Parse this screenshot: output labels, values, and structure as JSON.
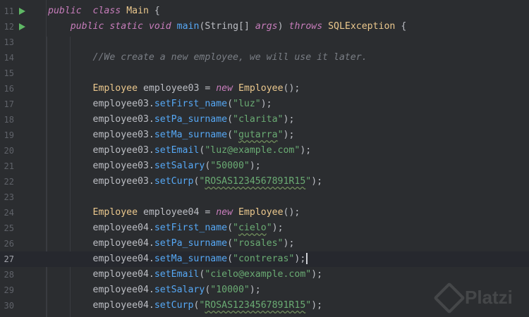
{
  "editor": {
    "lines": [
      {
        "num": "11",
        "run": true,
        "tokens": [
          [
            "kw-i",
            "public"
          ],
          [
            "",
            "  "
          ],
          [
            "kw-i",
            "class"
          ],
          [
            "",
            " "
          ],
          [
            "cls",
            "Main"
          ],
          [
            "",
            " {"
          ]
        ]
      },
      {
        "num": "12",
        "run": true,
        "tokens": [
          [
            "",
            "    "
          ],
          [
            "kw-i",
            "public"
          ],
          [
            "",
            " "
          ],
          [
            "kw-i",
            "static"
          ],
          [
            "",
            " "
          ],
          [
            "kw-i",
            "void"
          ],
          [
            "",
            " "
          ],
          [
            "fn",
            "main"
          ],
          [
            "",
            "(String[] "
          ],
          [
            "kw-i",
            "args"
          ],
          [
            "",
            ") "
          ],
          [
            "kw-i",
            "throws"
          ],
          [
            "",
            " "
          ],
          [
            "cls",
            "SQLException"
          ],
          [
            "",
            " {"
          ]
        ]
      },
      {
        "num": "13",
        "tokens": []
      },
      {
        "num": "14",
        "tokens": [
          [
            "",
            "        "
          ],
          [
            "cmt",
            "//We create a new employee, we will use it later."
          ]
        ]
      },
      {
        "num": "15",
        "tokens": []
      },
      {
        "num": "16",
        "tokens": [
          [
            "",
            "        "
          ],
          [
            "cls",
            "Employee"
          ],
          [
            "",
            " employee03 = "
          ],
          [
            "kw-i",
            "new"
          ],
          [
            "",
            " "
          ],
          [
            "cls",
            "Employee"
          ],
          [
            "",
            "();"
          ]
        ]
      },
      {
        "num": "17",
        "tokens": [
          [
            "",
            "        employee03."
          ],
          [
            "fn",
            "setFirst_name"
          ],
          [
            "",
            "("
          ],
          [
            "str",
            "\"luz\""
          ],
          [
            "",
            ");"
          ]
        ]
      },
      {
        "num": "18",
        "tokens": [
          [
            "",
            "        employee03."
          ],
          [
            "fn",
            "setPa_surname"
          ],
          [
            "",
            "("
          ],
          [
            "str",
            "\"clarita\""
          ],
          [
            "",
            ");"
          ]
        ]
      },
      {
        "num": "19",
        "tokens": [
          [
            "",
            "        employee03."
          ],
          [
            "fn",
            "setMa_surname"
          ],
          [
            "",
            "("
          ],
          [
            "str",
            "\""
          ],
          [
            "str wavy",
            "gutarra"
          ],
          [
            "str",
            "\""
          ],
          [
            "",
            ");"
          ]
        ]
      },
      {
        "num": "20",
        "tokens": [
          [
            "",
            "        employee03."
          ],
          [
            "fn",
            "setEmail"
          ],
          [
            "",
            "("
          ],
          [
            "str",
            "\"luz@example.com\""
          ],
          [
            "",
            ");"
          ]
        ]
      },
      {
        "num": "21",
        "tokens": [
          [
            "",
            "        employee03."
          ],
          [
            "fn",
            "setSalary"
          ],
          [
            "",
            "("
          ],
          [
            "str",
            "\"50000\""
          ],
          [
            "",
            ");"
          ]
        ]
      },
      {
        "num": "22",
        "tokens": [
          [
            "",
            "        employee03."
          ],
          [
            "fn",
            "setCurp"
          ],
          [
            "",
            "("
          ],
          [
            "str",
            "\""
          ],
          [
            "str wavy",
            "ROSAS1234567891R15"
          ],
          [
            "str",
            "\""
          ],
          [
            "",
            ");"
          ]
        ]
      },
      {
        "num": "23",
        "tokens": []
      },
      {
        "num": "24",
        "tokens": [
          [
            "",
            "        "
          ],
          [
            "cls",
            "Employee"
          ],
          [
            "",
            " employee04 = "
          ],
          [
            "kw-i",
            "new"
          ],
          [
            "",
            " "
          ],
          [
            "cls",
            "Employee"
          ],
          [
            "",
            "();"
          ]
        ]
      },
      {
        "num": "25",
        "tokens": [
          [
            "",
            "        employee04."
          ],
          [
            "fn",
            "setFirst_name"
          ],
          [
            "",
            "("
          ],
          [
            "str",
            "\""
          ],
          [
            "str wavy",
            "cielo"
          ],
          [
            "str",
            "\""
          ],
          [
            "",
            ");"
          ]
        ]
      },
      {
        "num": "26",
        "tokens": [
          [
            "",
            "        employee04."
          ],
          [
            "fn",
            "setPa_surname"
          ],
          [
            "",
            "("
          ],
          [
            "str",
            "\"rosales\""
          ],
          [
            "",
            ");"
          ]
        ]
      },
      {
        "num": "27",
        "current": true,
        "tokens": [
          [
            "",
            "        employee04."
          ],
          [
            "fn",
            "setMa_surname"
          ],
          [
            "",
            "("
          ],
          [
            "str",
            "\"contreras\""
          ],
          [
            "",
            ");"
          ]
        ]
      },
      {
        "num": "28",
        "tokens": [
          [
            "",
            "        employee04."
          ],
          [
            "fn",
            "setEmail"
          ],
          [
            "",
            "("
          ],
          [
            "str",
            "\"cielo@example.com\""
          ],
          [
            "",
            ");"
          ]
        ]
      },
      {
        "num": "29",
        "tokens": [
          [
            "",
            "        employee04."
          ],
          [
            "fn",
            "setSalary"
          ],
          [
            "",
            "("
          ],
          [
            "str",
            "\"10000\""
          ],
          [
            "",
            ");"
          ]
        ]
      },
      {
        "num": "30",
        "tokens": [
          [
            "",
            "        employee04."
          ],
          [
            "fn",
            "setCurp"
          ],
          [
            "",
            "("
          ],
          [
            "str",
            "\""
          ],
          [
            "str wavy",
            "ROSAS1234567891R15"
          ],
          [
            "str",
            "\""
          ],
          [
            "",
            ");"
          ]
        ]
      }
    ]
  },
  "watermark": {
    "text": "Platzi",
    "icon": "platzi-logo-icon"
  },
  "colors": {
    "background": "#2b2d30",
    "keyword": "#c77dbb",
    "class": "#ebc88d",
    "method": "#56a8f5",
    "string": "#6aab73",
    "comment": "#7a7e85",
    "run_icon": "#5fb865"
  }
}
